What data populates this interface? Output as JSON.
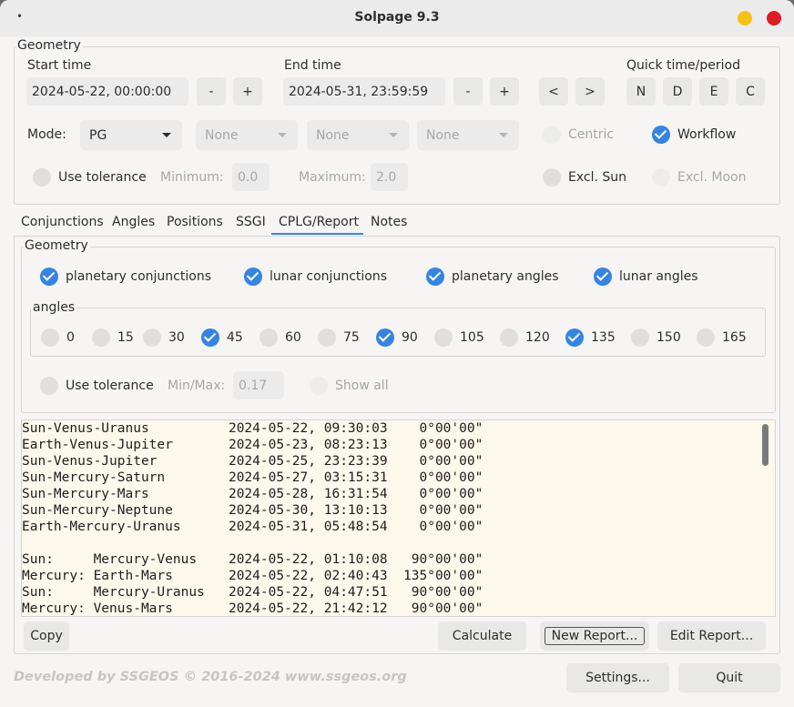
{
  "window": {
    "title": "Solpage 9.3",
    "menu_glyph": "•",
    "colors": {
      "minimize": "#f5c211",
      "close": "#e01b24",
      "accent": "#3584e4"
    }
  },
  "geometry": {
    "legend": "Geometry",
    "start_time": {
      "label": "Start time",
      "value": "2024-05-22, 00:00:00",
      "minus": "-",
      "plus": "+"
    },
    "end_time": {
      "label": "End time",
      "value": "2024-05-31, 23:59:59",
      "minus": "-",
      "plus": "+"
    },
    "quick": {
      "label": "Quick time/period",
      "prev": "<",
      "next": ">",
      "n": "N",
      "d": "D",
      "e": "E",
      "c": "C"
    },
    "mode": {
      "label": "Mode:",
      "value": "PG",
      "combo2": "None",
      "combo3": "None",
      "combo4": "None"
    },
    "centric": {
      "label": "Centric",
      "checked": false,
      "enabled": false
    },
    "workflow": {
      "label": "Workflow",
      "checked": true
    },
    "use_tolerance": {
      "label": "Use tolerance",
      "checked": false
    },
    "minimum": {
      "label": "Minimum:",
      "value": "0.0"
    },
    "maximum": {
      "label": "Maximum:",
      "value": "2.0"
    },
    "excl_sun": {
      "label": "Excl. Sun",
      "checked": false
    },
    "excl_moon": {
      "label": "Excl. Moon",
      "checked": false,
      "enabled": false
    }
  },
  "tabs": [
    "Conjunctions",
    "Angles",
    "Positions",
    "SSGI",
    "CPLG/Report",
    "Notes"
  ],
  "active_tab": "CPLG/Report",
  "cplg": {
    "legend": "Geometry",
    "options": [
      {
        "label": "planetary conjunctions",
        "checked": true
      },
      {
        "label": "lunar conjunctions",
        "checked": true
      },
      {
        "label": "planetary angles",
        "checked": true
      },
      {
        "label": "lunar angles",
        "checked": true
      }
    ],
    "angles_legend": "angles",
    "angles": [
      {
        "label": "0",
        "checked": false
      },
      {
        "label": "15",
        "checked": false
      },
      {
        "label": "30",
        "checked": false
      },
      {
        "label": "45",
        "checked": true
      },
      {
        "label": "60",
        "checked": false
      },
      {
        "label": "75",
        "checked": false
      },
      {
        "label": "90",
        "checked": true
      },
      {
        "label": "105",
        "checked": false
      },
      {
        "label": "120",
        "checked": false
      },
      {
        "label": "135",
        "checked": true
      },
      {
        "label": "150",
        "checked": false
      },
      {
        "label": "165",
        "checked": false
      }
    ],
    "use_tolerance": {
      "label": "Use tolerance",
      "checked": false
    },
    "minmax": {
      "label": "Min/Max:",
      "value": "0.17"
    },
    "show_all": {
      "label": "Show all",
      "checked": false,
      "enabled": false
    }
  },
  "report_lines": [
    "Sun-Venus-Uranus          2024-05-22, 09:30:03    0°00'00\"",
    "Earth-Venus-Jupiter       2024-05-23, 08:23:13    0°00'00\"",
    "Sun-Venus-Jupiter         2024-05-25, 23:23:39    0°00'00\"",
    "Sun-Mercury-Saturn        2024-05-27, 03:15:31    0°00'00\"",
    "Sun-Mercury-Mars          2024-05-28, 16:31:54    0°00'00\"",
    "Sun-Mercury-Neptune       2024-05-30, 13:10:13    0°00'00\"",
    "Earth-Mercury-Uranus      2024-05-31, 05:48:54    0°00'00\"",
    "",
    "Sun:     Mercury-Venus    2024-05-22, 01:10:08   90°00'00\"",
    "Mercury: Earth-Mars       2024-05-22, 02:40:43  135°00'00\"",
    "Sun:     Mercury-Uranus   2024-05-22, 04:47:51   90°00'00\"",
    "Mercury: Venus-Mars       2024-05-22, 21:42:12   90°00'00\""
  ],
  "buttons": {
    "copy": "Copy",
    "calculate": "Calculate",
    "new_report": "New Report...",
    "edit_report": "Edit Report...",
    "settings": "Settings...",
    "quit": "Quit"
  },
  "footer": "Developed by SSGEOS © 2016-2024 www.ssgeos.org"
}
